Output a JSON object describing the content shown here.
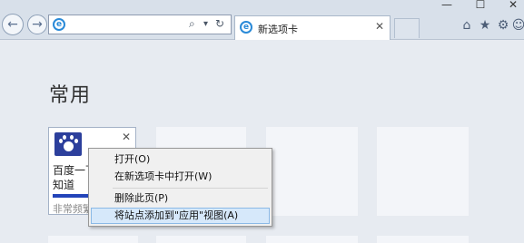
{
  "toolbar": {
    "back_glyph": "←",
    "forward_glyph": "→",
    "address_value": "",
    "search_glyph": "⌕",
    "dropdown_glyph": "▾",
    "refresh_glyph": "↻",
    "ie_glyph": "e",
    "home_glyph": "⌂",
    "favorites_glyph": "★",
    "tools_glyph": "⚙",
    "feedback_glyph": "☺",
    "window_min": "—",
    "window_max": "☐",
    "window_close": "✕"
  },
  "tab": {
    "title": "新选项卡",
    "close": "✕"
  },
  "page": {
    "heading": "常用"
  },
  "site_tile": {
    "title": "百度一下，你就\n知道",
    "close": "✕",
    "footer": "非常频繁"
  },
  "context_menu": {
    "items": [
      {
        "label": "打开(O)"
      },
      {
        "label": "在新选项卡中打开(W)"
      },
      {
        "label": "删除此页(P)"
      },
      {
        "label": "将站点添加到\"应用\"视图(A)"
      }
    ]
  },
  "colors": {
    "accent": "#2344b9",
    "menu_highlight": "#d6e8fa",
    "page_bg": "#e7ebf1"
  },
  "icons": [
    "back-icon",
    "forward-icon",
    "ie-icon",
    "search-icon",
    "refresh-icon",
    "home-icon",
    "favorites-icon",
    "gear-icon",
    "smiley-icon",
    "baidu-paw-icon",
    "close-icon"
  ]
}
